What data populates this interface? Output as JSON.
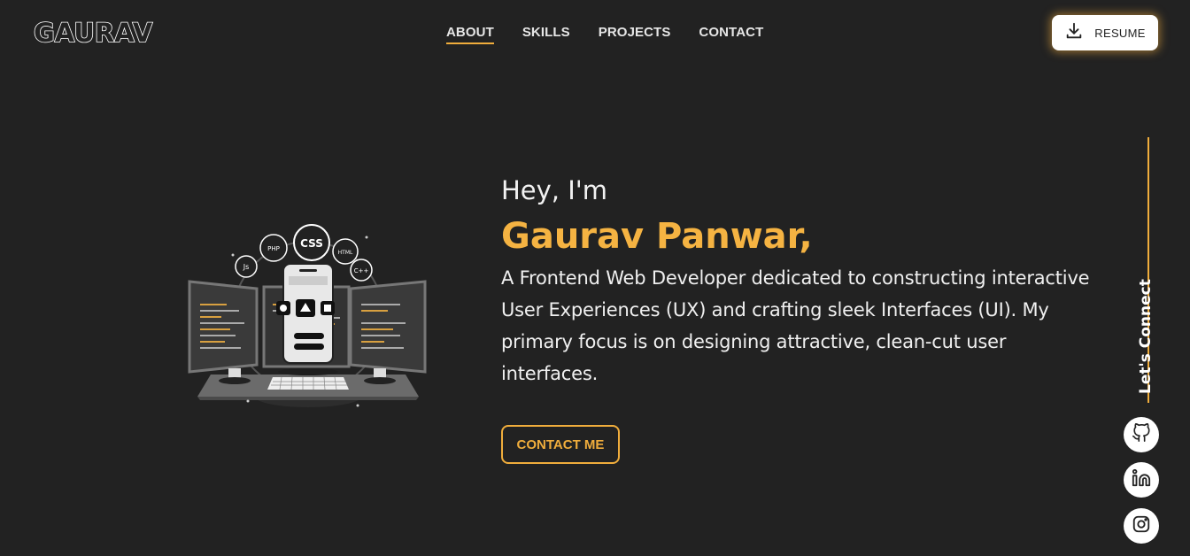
{
  "header": {
    "logo": "GAURAV",
    "nav": [
      {
        "label": "ABOUT",
        "active": true
      },
      {
        "label": "SKILLS",
        "active": false
      },
      {
        "label": "PROJECTS",
        "active": false
      },
      {
        "label": "CONTACT",
        "active": false
      }
    ],
    "resume_label": "RESUME",
    "resume_icon": "download-icon"
  },
  "hero": {
    "greeting": "Hey, I'm",
    "name": "Gaurav Panwar,",
    "description": "A Frontend Web Developer dedicated to constructing interactive User Experiences (UX) and crafting sleek Interfaces (UI). My primary focus is on designing attractive, clean-cut user interfaces.",
    "cta_label": "CONTACT ME",
    "illustration_badges": [
      "CSS",
      "PHP",
      "Js",
      "HTML",
      "C++"
    ]
  },
  "sidebar": {
    "connect_label": "Let's Connect",
    "socials": [
      {
        "name": "github",
        "icon": "github-icon"
      },
      {
        "name": "linkedin",
        "icon": "linkedin-icon"
      },
      {
        "name": "instagram",
        "icon": "instagram-icon"
      }
    ]
  },
  "colors": {
    "background": "#222222",
    "accent": "#f0ad3c",
    "name": "#f5b342",
    "text": "#f0f0f0"
  }
}
